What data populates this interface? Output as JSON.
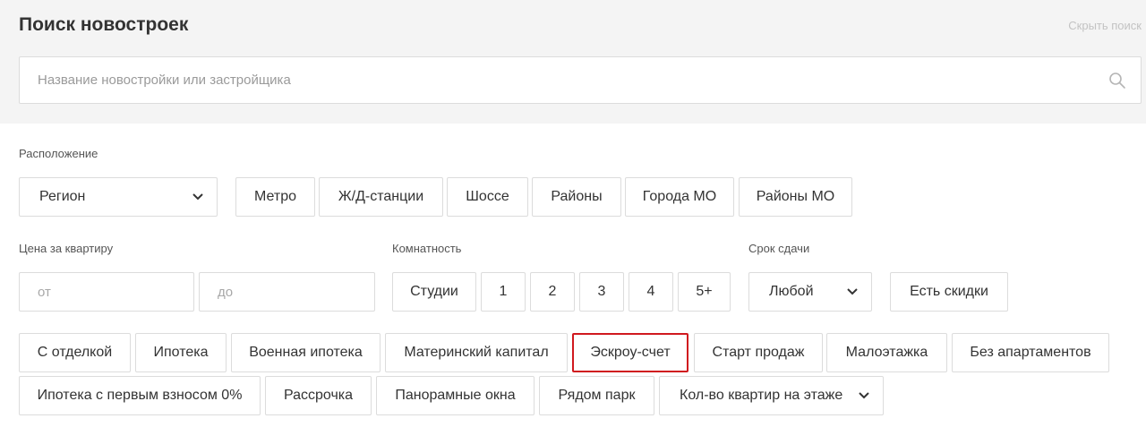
{
  "header": {
    "title": "Поиск новостроек",
    "hide_link": "Скрыть поиск"
  },
  "search": {
    "placeholder": "Название новостройки или застройщика",
    "value": ""
  },
  "location": {
    "label": "Расположение",
    "region_select": "Регион",
    "buttons": [
      "Метро",
      "Ж/Д-станции",
      "Шоссе",
      "Районы",
      "Города МО",
      "Районы МО"
    ]
  },
  "price": {
    "label": "Цена за квартиру",
    "from_placeholder": "от",
    "to_placeholder": "до"
  },
  "rooms": {
    "label": "Комнатность",
    "options": [
      "Студии",
      "1",
      "2",
      "3",
      "4",
      "5+"
    ]
  },
  "deadline": {
    "label": "Срок сдачи",
    "select": "Любой",
    "discount_button": "Есть скидки"
  },
  "features": {
    "row1": [
      "С отделкой",
      "Ипотека",
      "Военная ипотека",
      "Материнский капитал",
      "Эскроу-счет",
      "Старт продаж",
      "Малоэтажка",
      "Без апартаментов"
    ],
    "row2": [
      "Ипотека с первым взносом 0%",
      "Рассрочка",
      "Панорамные окна",
      "Рядом парк"
    ],
    "flats_per_floor_select": "Кол-во квартир на этаже",
    "highlighted": "Эскроу-счет"
  },
  "colors": {
    "highlight_border": "#d0191f",
    "top_background": "#f4f4f4"
  }
}
